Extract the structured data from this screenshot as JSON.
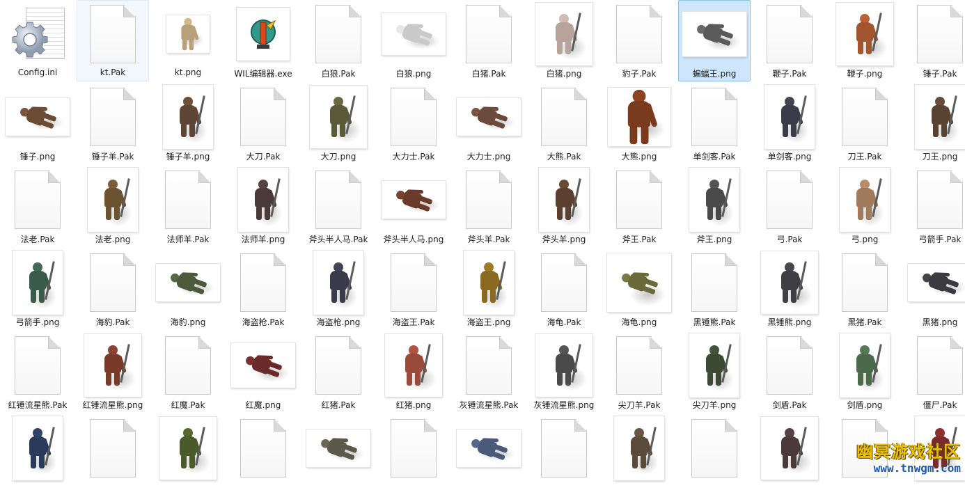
{
  "window": {
    "title": ""
  },
  "files": [
    {
      "name": "Config.ini",
      "kind": "config",
      "state": ""
    },
    {
      "name": "kt.Pak",
      "kind": "doc",
      "state": "hover"
    },
    {
      "name": "kt.png",
      "kind": "img",
      "color": "#b8a07a",
      "shape": "cat"
    },
    {
      "name": "WIL编辑器.exe",
      "kind": "exe"
    },
    {
      "name": "白狼.Pak",
      "kind": "doc"
    },
    {
      "name": "白狼.png",
      "kind": "img",
      "color": "#c9c9c9",
      "shape": "wolf"
    },
    {
      "name": "白猪.Pak",
      "kind": "doc"
    },
    {
      "name": "白猪.png",
      "kind": "img",
      "color": "#b7a39a",
      "shape": "brute"
    },
    {
      "name": "豹子.Pak",
      "kind": "doc"
    },
    {
      "name": "蝙蝠王.png",
      "kind": "img",
      "color": "#5a5a5a",
      "shape": "bat",
      "state": "selected"
    },
    {
      "name": "鞭子.Pak",
      "kind": "doc"
    },
    {
      "name": "鞭子.png",
      "kind": "img",
      "color": "#a3552e",
      "shape": "brute"
    },
    {
      "name": "锤子.Pak",
      "kind": "doc"
    },
    {
      "name": "锤子.png",
      "kind": "img",
      "color": "#6b4b34",
      "shape": "crawl"
    },
    {
      "name": "锤子羊.Pak",
      "kind": "doc"
    },
    {
      "name": "锤子羊.png",
      "kind": "img",
      "color": "#5d4636",
      "shape": "humanoid"
    },
    {
      "name": "大刀.Pak",
      "kind": "doc"
    },
    {
      "name": "大刀.png",
      "kind": "img",
      "color": "#5b5a38",
      "shape": "brute"
    },
    {
      "name": "大力士.Pak",
      "kind": "doc"
    },
    {
      "name": "大力士.png",
      "kind": "img",
      "color": "#6a4a3a",
      "shape": "crawl"
    },
    {
      "name": "大熊.Pak",
      "kind": "doc"
    },
    {
      "name": "大熊.png",
      "kind": "img",
      "color": "#7a3a1e",
      "shape": "bear"
    },
    {
      "name": "单剑客.Pak",
      "kind": "doc"
    },
    {
      "name": "单剑客.png",
      "kind": "img",
      "color": "#3b3b4a",
      "shape": "humanoid"
    },
    {
      "name": "刀王.Pak",
      "kind": "doc"
    },
    {
      "name": "刀王.png",
      "kind": "img",
      "color": "#5a4232",
      "shape": "humanoid"
    },
    {
      "name": "法老.Pak",
      "kind": "doc"
    },
    {
      "name": "法老.png",
      "kind": "img",
      "color": "#6b5230",
      "shape": "humanoid"
    },
    {
      "name": "法师羊.Pak",
      "kind": "doc"
    },
    {
      "name": "法师羊.png",
      "kind": "img",
      "color": "#4a3a3a",
      "shape": "humanoid"
    },
    {
      "name": "斧头半人马.Pak",
      "kind": "doc"
    },
    {
      "name": "斧头半人马.png",
      "kind": "img",
      "color": "#6a3a2a",
      "shape": "crawl"
    },
    {
      "name": "斧头羊.Pak",
      "kind": "doc"
    },
    {
      "name": "斧头羊.png",
      "kind": "img",
      "color": "#5b4030",
      "shape": "humanoid"
    },
    {
      "name": "斧王.Pak",
      "kind": "doc"
    },
    {
      "name": "斧王.png",
      "kind": "img",
      "color": "#4a4a4a",
      "shape": "humanoid"
    },
    {
      "name": "弓.Pak",
      "kind": "doc"
    },
    {
      "name": "弓.png",
      "kind": "img",
      "color": "#a07a5a",
      "shape": "humanoid"
    },
    {
      "name": "弓箭手.Pak",
      "kind": "doc"
    },
    {
      "name": "弓箭手.png",
      "kind": "img",
      "color": "#3a5a4a",
      "shape": "humanoid"
    },
    {
      "name": "海豹.Pak",
      "kind": "doc"
    },
    {
      "name": "海豹.png",
      "kind": "img",
      "color": "#4a5a3a",
      "shape": "crawl"
    },
    {
      "name": "海盗枪.Pak",
      "kind": "doc"
    },
    {
      "name": "海盗枪.png",
      "kind": "img",
      "color": "#3a3a4a",
      "shape": "humanoid"
    },
    {
      "name": "海盗王.Pak",
      "kind": "doc"
    },
    {
      "name": "海盗王.png",
      "kind": "img",
      "color": "#8a6a20",
      "shape": "humanoid"
    },
    {
      "name": "海龟.Pak",
      "kind": "doc"
    },
    {
      "name": "海龟.png",
      "kind": "img",
      "color": "#6a6a3a",
      "shape": "turtle"
    },
    {
      "name": "黑锤熊.Pak",
      "kind": "doc"
    },
    {
      "name": "黑锤熊.png",
      "kind": "img",
      "color": "#3e3e44",
      "shape": "brute"
    },
    {
      "name": "黑猪.Pak",
      "kind": "doc"
    },
    {
      "name": "黑猪.png",
      "kind": "img",
      "color": "#3b3a3e",
      "shape": "crawl"
    },
    {
      "name": "红锤流星熊.Pak",
      "kind": "doc"
    },
    {
      "name": "红锤流星熊.png",
      "kind": "img",
      "color": "#7a3a2a",
      "shape": "brute"
    },
    {
      "name": "红魔.Pak",
      "kind": "doc"
    },
    {
      "name": "红魔.png",
      "kind": "img",
      "color": "#6a2a2a",
      "shape": "bat"
    },
    {
      "name": "红猪.Pak",
      "kind": "doc"
    },
    {
      "name": "红猪.png",
      "kind": "img",
      "color": "#9a4a3a",
      "shape": "brute"
    },
    {
      "name": "灰锤流星熊.Pak",
      "kind": "doc"
    },
    {
      "name": "灰锤流星熊.png",
      "kind": "img",
      "color": "#4a4a4a",
      "shape": "brute"
    },
    {
      "name": "尖刀羊.Pak",
      "kind": "doc"
    },
    {
      "name": "尖刀羊.png",
      "kind": "img",
      "color": "#3a4a34",
      "shape": "humanoid"
    },
    {
      "name": "剑盾.Pak",
      "kind": "doc"
    },
    {
      "name": "剑盾.png",
      "kind": "img",
      "color": "#4a6a4a",
      "shape": "humanoid"
    },
    {
      "name": "僵尸.Pak",
      "kind": "doc"
    },
    {
      "name": "",
      "kind": "img",
      "color": "#2a3a5a",
      "shape": "humanoid"
    },
    {
      "name": "",
      "kind": "doc"
    },
    {
      "name": "",
      "kind": "img",
      "color": "#4a5a2a",
      "shape": "brute"
    },
    {
      "name": "",
      "kind": "doc"
    },
    {
      "name": "",
      "kind": "img",
      "color": "#5a5a4a",
      "shape": "crawl"
    },
    {
      "name": "",
      "kind": "doc"
    },
    {
      "name": "",
      "kind": "img",
      "color": "#4a5a7a",
      "shape": "crawl"
    },
    {
      "name": "",
      "kind": "doc"
    },
    {
      "name": "",
      "kind": "img",
      "color": "#5a4a3a",
      "shape": "humanoid"
    },
    {
      "name": "",
      "kind": "doc"
    },
    {
      "name": "",
      "kind": "img",
      "color": "#4a3a3a",
      "shape": "brute"
    },
    {
      "name": "",
      "kind": "doc"
    },
    {
      "name": "",
      "kind": "img",
      "color": "#7a2a2a",
      "shape": "humanoid"
    }
  ],
  "watermark": {
    "title": "幽冥游戏社区",
    "url": "www.tnwgm.com"
  }
}
